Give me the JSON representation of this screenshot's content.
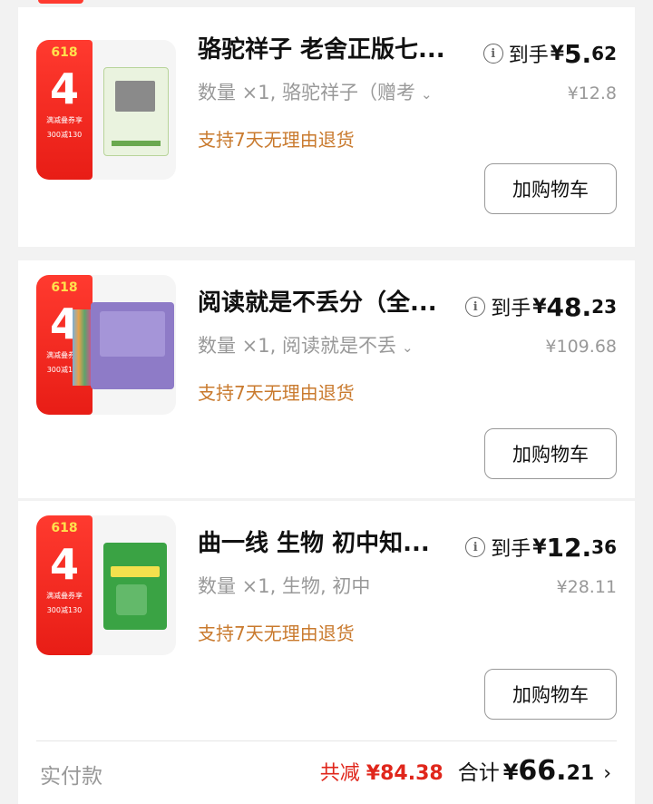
{
  "items": [
    {
      "title": "骆驼祥子 老舍正版七...",
      "spec": "数量 ×1, 骆驼祥子（赠考",
      "return_policy": "支持7天无理由退货",
      "price_label": "到手",
      "price_currency": "¥",
      "price_int": "5.",
      "price_dec": "62",
      "original_price": "¥12.8",
      "cart_button": "加购物车",
      "product_cover_color": "#eaf3df",
      "promo": {
        "tag": "618",
        "big": "4",
        "line1": "满减叠券享",
        "line2": "300减130"
      }
    },
    {
      "title": "阅读就是不丢分（全...",
      "spec": "数量 ×1, 阅读就是不丢",
      "return_policy": "支持7天无理由退货",
      "price_label": "到手",
      "price_currency": "¥",
      "price_int": "48.",
      "price_dec": "23",
      "original_price": "¥109.68",
      "cart_button": "加购物车",
      "product_cover_color": "#8e7bc7",
      "promo": {
        "tag": "618",
        "big": "4",
        "line1": "满减叠券享",
        "line2": "300减130"
      }
    },
    {
      "title": "曲一线 生物 初中知...",
      "spec": "数量 ×1, 生物, 初中",
      "return_policy": "支持7天无理由退货",
      "price_label": "到手",
      "price_currency": "¥",
      "price_int": "12.",
      "price_dec": "36",
      "original_price": "¥28.11",
      "cart_button": "加购物车",
      "product_cover_color": "#3aa344",
      "promo": {
        "tag": "618",
        "big": "4",
        "line1": "满减叠券享",
        "line2": "300减130"
      }
    }
  ],
  "footer": {
    "label": "实付款",
    "discount_label": "共减",
    "discount_value": "¥84.38",
    "total_label": "合计",
    "total_currency": "¥",
    "total_int": "66.",
    "total_dec": "21"
  },
  "colors": {
    "accent_red": "#e0261b",
    "return_orange": "#c97a2e"
  }
}
